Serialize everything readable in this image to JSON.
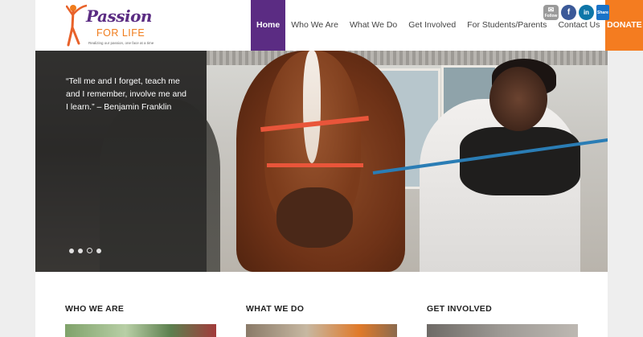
{
  "logo": {
    "name_top": "Passion",
    "name_bottom": "FOR LIFE",
    "tagline": "Realizing our passion, one face at a time"
  },
  "nav": {
    "items": [
      {
        "label": "Home",
        "active": true
      },
      {
        "label": "Who We Are",
        "active": false
      },
      {
        "label": "What We Do",
        "active": false
      },
      {
        "label": "Get Involved",
        "active": false
      },
      {
        "label": "For Students/Parents",
        "active": false
      },
      {
        "label": "Contact Us",
        "active": false
      }
    ],
    "donate_label": "DONATE"
  },
  "socials": {
    "email_label": "Follow",
    "facebook_glyph": "f",
    "linkedin_glyph": "in",
    "share_label": "Share"
  },
  "hero": {
    "quote": "“Tell me and I forget, teach me and I remember, involve me and I learn.” – Benjamin Franklin",
    "slide_count": 4,
    "active_slide": 3
  },
  "sections": [
    {
      "title": "WHO WE ARE"
    },
    {
      "title": "WHAT WE DO"
    },
    {
      "title": "GET INVOLVED"
    }
  ],
  "colors": {
    "brand_purple": "#5b2c83",
    "brand_orange": "#f47c20",
    "facebook": "#3b5998",
    "linkedin": "#0e76a8"
  },
  "icons": [
    "runner-logo-icon",
    "email-icon",
    "facebook-icon",
    "linkedin-icon",
    "share-icon"
  ]
}
